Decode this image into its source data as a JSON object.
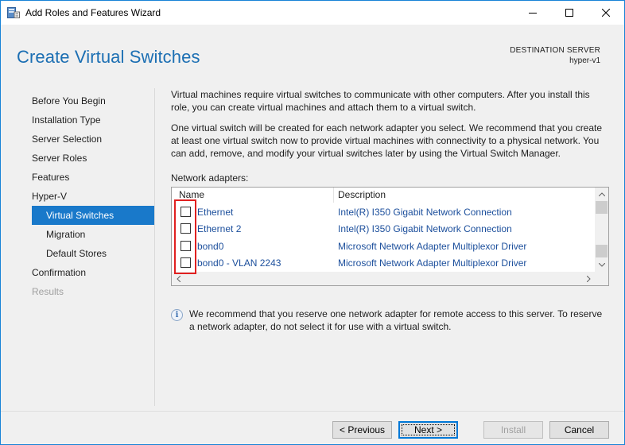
{
  "window": {
    "title": "Add Roles and Features Wizard",
    "controls": {
      "minimize": "—",
      "maximize": "☐",
      "close": "✕"
    }
  },
  "header": {
    "page_title": "Create Virtual Switches",
    "destination_label": "DESTINATION SERVER",
    "destination_server": "hyper-v1"
  },
  "nav": {
    "items": [
      {
        "label": "Before You Begin",
        "state": "normal"
      },
      {
        "label": "Installation Type",
        "state": "normal"
      },
      {
        "label": "Server Selection",
        "state": "normal"
      },
      {
        "label": "Server Roles",
        "state": "normal"
      },
      {
        "label": "Features",
        "state": "normal"
      },
      {
        "label": "Hyper-V",
        "state": "normal"
      },
      {
        "label": "Virtual Switches",
        "state": "active"
      },
      {
        "label": "Migration",
        "state": "normal"
      },
      {
        "label": "Default Stores",
        "state": "normal"
      },
      {
        "label": "Confirmation",
        "state": "normal"
      },
      {
        "label": "Results",
        "state": "disabled"
      }
    ]
  },
  "content": {
    "paragraph1": "Virtual machines require virtual switches to communicate with other computers. After you install this role, you can create virtual machines and attach them to a virtual switch.",
    "paragraph2": "One virtual switch will be created for each network adapter you select. We recommend that you create at least one virtual switch now to provide virtual machines with connectivity to a physical network. You can add, remove, and modify your virtual switches later by using the Virtual Switch Manager.",
    "adapters_label": "Network adapters:",
    "columns": {
      "name": "Name",
      "description": "Description"
    },
    "adapters": [
      {
        "name": "Ethernet",
        "description": "Intel(R) I350 Gigabit Network Connection",
        "checked": false
      },
      {
        "name": "Ethernet 2",
        "description": "Intel(R) I350 Gigabit Network Connection",
        "checked": false
      },
      {
        "name": "bond0",
        "description": "Microsoft Network Adapter Multiplexor Driver",
        "checked": false
      },
      {
        "name": "bond0 - VLAN 2243",
        "description": "Microsoft Network Adapter Multiplexor Driver",
        "checked": false
      }
    ],
    "info_text": "We recommend that you reserve one network adapter for remote access to this server. To reserve a network adapter, do not select it for use with a virtual switch."
  },
  "footer": {
    "previous": "< Previous",
    "next": "Next >",
    "install": "Install",
    "cancel": "Cancel"
  },
  "colors": {
    "accent": "#1979ca",
    "title_blue": "#1c6fb3",
    "link_blue": "#1c4f9c",
    "highlight_red": "#e02020"
  }
}
